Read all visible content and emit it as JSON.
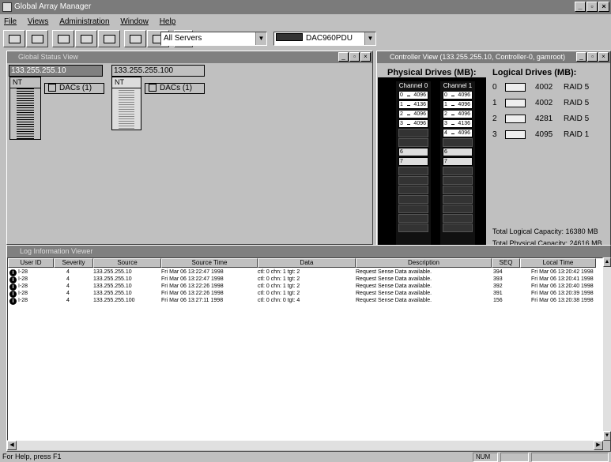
{
  "app": {
    "title": "Global Array Manager"
  },
  "menu": [
    "File",
    "Views",
    "Administration",
    "Window",
    "Help"
  ],
  "toolbar": {
    "server_select": "All Servers",
    "controller_select": "DAC960PDU"
  },
  "global_status": {
    "title": "Global Status View",
    "servers": [
      {
        "ip": "133.255.255.10",
        "os": "NT",
        "dacs": "DACs (1)"
      },
      {
        "ip": "133.255.255.100",
        "os": "NT",
        "dacs": "DACs (1)"
      }
    ]
  },
  "controller_view": {
    "title": "Controller View (133.255.255.10, Controller-0, gamroot)",
    "physical_heading": "Physical Drives (MB):",
    "logical_heading": "Logical Drives (MB):",
    "channels": [
      {
        "label": "Channel 0",
        "drives": [
          {
            "id": "0",
            "size": "4096"
          },
          {
            "id": "1",
            "size": "4136"
          },
          {
            "id": "2",
            "size": "4096"
          },
          {
            "id": "3",
            "size": "4096"
          }
        ],
        "controllers": [
          "6",
          "7"
        ]
      },
      {
        "label": "Channel 1",
        "drives": [
          {
            "id": "0",
            "size": "4096"
          },
          {
            "id": "1",
            "size": "4096"
          },
          {
            "id": "2",
            "size": "4096"
          },
          {
            "id": "3",
            "size": "4136"
          },
          {
            "id": "4",
            "size": "4096"
          }
        ],
        "controllers": [
          "6",
          "7"
        ]
      }
    ],
    "logical_drives": [
      {
        "num": "0",
        "capacity": "4002",
        "raid": "RAID 5"
      },
      {
        "num": "1",
        "capacity": "4002",
        "raid": "RAID 5"
      },
      {
        "num": "2",
        "capacity": "4281",
        "raid": "RAID 5"
      },
      {
        "num": "3",
        "capacity": "4095",
        "raid": "RAID 1"
      }
    ],
    "total_logical": "Total Logical Capacity:  16380 MB",
    "total_physical": "Total Physical Capacity:  24616 MB"
  },
  "log": {
    "title": "Log Information Viewer",
    "columns": [
      "User ID",
      "Severity",
      "Source",
      "Source Time",
      "Data",
      "Description",
      "SEQ",
      "Local Time"
    ],
    "rows": [
      [
        "I-28",
        "4",
        "133.255.255.10",
        "Fri Mar 06 13:22:47 1998",
        "ctl: 0 chn: 1 tgt: 2",
        "Request Sense Data available.",
        "394",
        "Fri Mar 06 13:20:42 1998"
      ],
      [
        "I-28",
        "4",
        "133.255.255.10",
        "Fri Mar 06 13:22:47 1998",
        "ctl: 0 chn: 1 tgt: 2",
        "Request Sense Data available.",
        "393",
        "Fri Mar 06 13:20:41 1998"
      ],
      [
        "I-28",
        "4",
        "133.255.255.10",
        "Fri Mar 06 13:22:26 1998",
        "ctl: 0 chn: 1 tgt: 2",
        "Request Sense Data available.",
        "392",
        "Fri Mar 06 13:20:40 1998"
      ],
      [
        "I-28",
        "4",
        "133.255.255.10",
        "Fri Mar 06 13:22:26 1998",
        "ctl: 0 chn: 1 tgt: 2",
        "Request Sense Data available.",
        "391",
        "Fri Mar 06 13:20:39 1998"
      ],
      [
        "I-28",
        "4",
        "133.255.255.100",
        "Fri Mar 06 13:27:11 1998",
        "ctl: 0 chn: 0 tgt: 4",
        "Request Sense Data available.",
        "156",
        "Fri Mar 06 13:20:38 1998"
      ]
    ]
  },
  "status": {
    "help": "For Help, press F1",
    "num": "NUM"
  }
}
